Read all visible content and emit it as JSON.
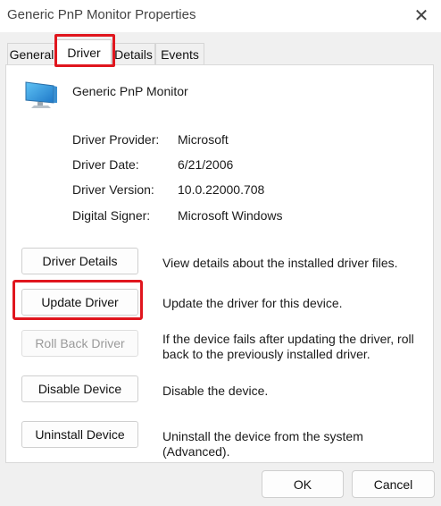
{
  "window": {
    "title": "Generic PnP Monitor Properties",
    "close_icon": "close-icon"
  },
  "tabs": [
    {
      "label": "General",
      "active": false
    },
    {
      "label": "Driver",
      "active": true
    },
    {
      "label": "Details",
      "active": false
    },
    {
      "label": "Events",
      "active": false
    }
  ],
  "device": {
    "icon": "monitor-icon",
    "name": "Generic PnP Monitor"
  },
  "info": [
    {
      "label": "Driver Provider:",
      "value": "Microsoft"
    },
    {
      "label": "Driver Date:",
      "value": "6/21/2006"
    },
    {
      "label": "Driver Version:",
      "value": "10.0.22000.708"
    },
    {
      "label": "Digital Signer:",
      "value": "Microsoft Windows"
    }
  ],
  "actions": [
    {
      "button": "Driver Details",
      "description": "View details about the installed driver files.",
      "enabled": true
    },
    {
      "button": "Update Driver",
      "description": "Update the driver for this device.",
      "enabled": true,
      "highlighted": true
    },
    {
      "button": "Roll Back Driver",
      "description": "If the device fails after updating the driver, roll back to the previously installed driver.",
      "enabled": false
    },
    {
      "button": "Disable Device",
      "description": "Disable the device.",
      "enabled": true
    },
    {
      "button": "Uninstall Device",
      "description": "Uninstall the device from the system (Advanced).",
      "enabled": true
    }
  ],
  "footer": {
    "ok_label": "OK",
    "cancel_label": "Cancel"
  },
  "colors": {
    "highlight_border": "#e0161e",
    "window_background": "#f0f0f0",
    "panel_background": "#ffffff"
  }
}
